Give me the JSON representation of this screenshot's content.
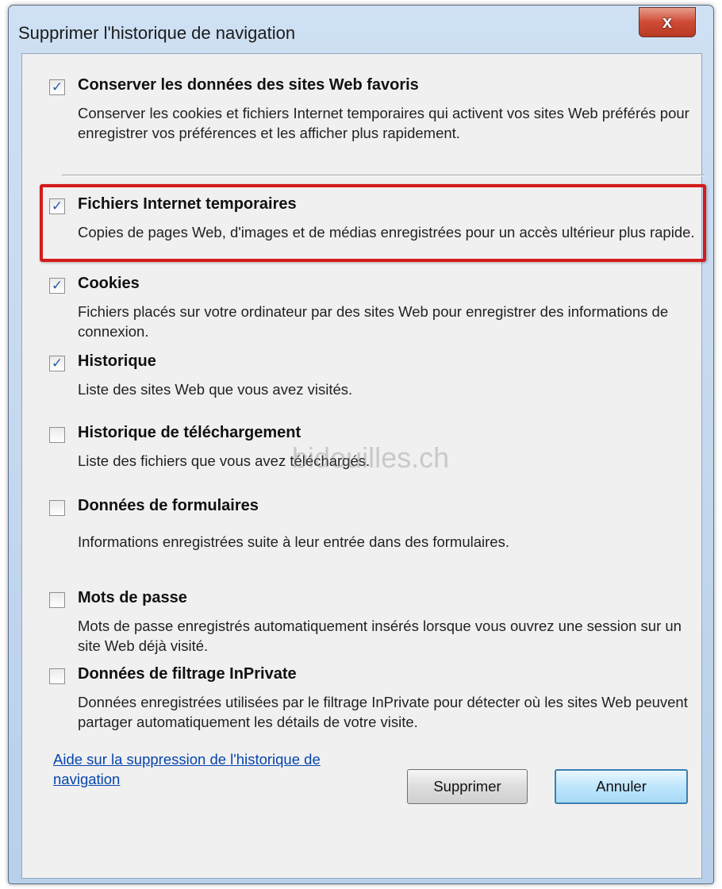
{
  "window": {
    "title": "Supprimer l'historique de navigation",
    "close_label": "x"
  },
  "options": [
    {
      "label": "Conserver les données des sites Web favoris",
      "checked": true,
      "description": "Conserver les cookies et fichiers Internet temporaires qui activent vos sites Web préférés pour enregistrer vos préférences et les afficher plus rapidement."
    },
    {
      "label": "Fichiers Internet temporaires",
      "checked": true,
      "description": "Copies de pages Web, d'images et de médias enregistrées pour un accès ultérieur plus rapide."
    },
    {
      "label": "Cookies",
      "checked": true,
      "description": "Fichiers placés sur votre ordinateur par des sites Web pour enregistrer des informations de connexion."
    },
    {
      "label": "Historique",
      "checked": true,
      "description": "Liste des sites Web que vous avez visités."
    },
    {
      "label": "Historique de téléchargement",
      "checked": false,
      "description": "Liste des fichiers que vous avez téléchargés."
    },
    {
      "label": "Données de formulaires",
      "checked": false,
      "description": "Informations enregistrées suite à leur entrée dans des formulaires."
    },
    {
      "label": "Mots de passe",
      "checked": false,
      "description": "Mots de passe enregistrés automatiquement insérés lorsque vous ouvrez une session sur un site Web déjà visité."
    },
    {
      "label": "Données de filtrage InPrivate",
      "checked": false,
      "description": "Données enregistrées utilisées par le filtrage InPrivate pour détecter où les sites Web peuvent partager automatiquement les détails de votre visite."
    }
  ],
  "watermark": "bidouilles.ch",
  "footer": {
    "help_link": "Aide sur la suppression de l'historique de navigation",
    "delete_label": "Supprimer",
    "cancel_label": "Annuler"
  },
  "colors": {
    "highlight": "#d41a1a",
    "link": "#0645ad"
  }
}
